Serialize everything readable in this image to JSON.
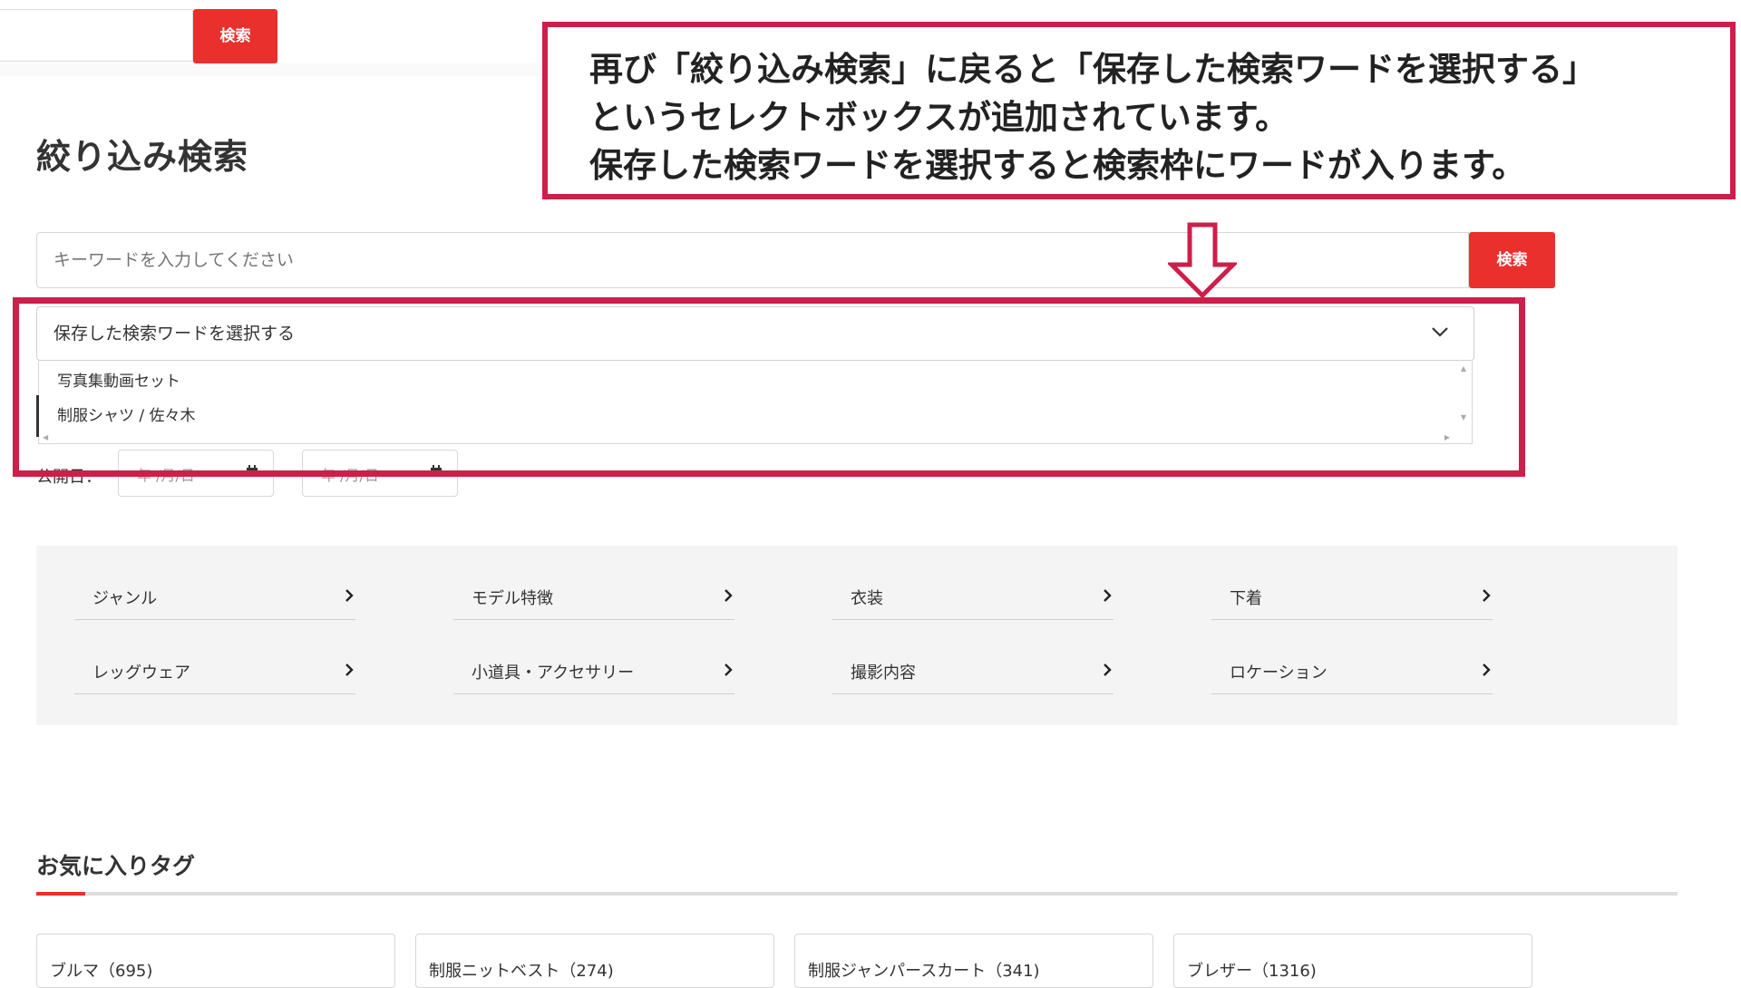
{
  "top_search": {
    "button_label": "検索"
  },
  "page_title": "絞り込み検索",
  "callout": {
    "lines": [
      "再び「絞り込み検索」に戻ると「保存した検索ワードを選択する」",
      "というセレクトボックスが追加されています。",
      "保存した検索ワードを選択すると検索枠にワードが入ります。"
    ]
  },
  "keyword_search": {
    "placeholder": "キーワードを入力してください",
    "button_label": "検索"
  },
  "saved_words_select": {
    "label": "保存した検索ワードを選択する",
    "options": [
      "写真集動画セット",
      "制服シャツ / 佐々木"
    ]
  },
  "date_filter": {
    "label": "公開日：",
    "from_placeholder": "年 /月/日",
    "to_placeholder": "年 /月/日"
  },
  "categories": [
    "ジャンル",
    "モデル特徴",
    "衣装",
    "下着",
    "レッグウェア",
    "小道具・アクセサリー",
    "撮影内容",
    "ロケーション"
  ],
  "favorite_tags": {
    "title": "お気に入りタグ",
    "tags": [
      "ブルマ（695)",
      "制服ニットベスト（274)",
      "制服ジャンパースカート（341)",
      "ブレザー（1316)"
    ]
  },
  "icons": {
    "dropdown": "chevron-down-icon",
    "category": "chevron-right-icon",
    "calendar": "calendar-icon",
    "callout_arrow": "down-arrow-icon"
  },
  "colors": {
    "accent_red": "#e9302c",
    "callout_border": "#cc1f4a"
  }
}
